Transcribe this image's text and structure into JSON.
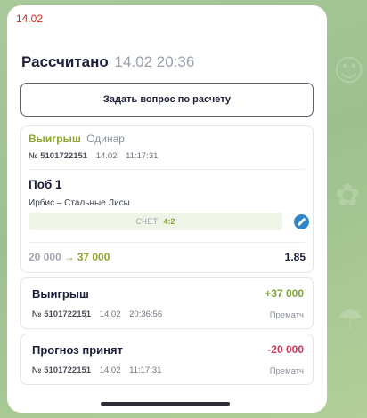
{
  "corner_date": "14.02",
  "header": {
    "title": "Рассчитано",
    "date": "14.02 20:36"
  },
  "ask_button": {
    "label": "Задать вопрос по расчету"
  },
  "bet": {
    "status": "Выигрыш",
    "type": "Одинар",
    "number": "№ 5101722151",
    "date": "14.02",
    "time": "11:17:31",
    "outcome": "Поб 1",
    "event": "Ирбис – Стальные Лисы",
    "score_label": "СЧЕТ",
    "score_value": "4:2",
    "sport_icon": "hockey-puck-icon",
    "stake": "20 000",
    "arrow": "→",
    "payout": "37 000",
    "odds": "1.85"
  },
  "transactions": [
    {
      "title": "Выигрыш",
      "amount": "+37 000",
      "number": "№ 5101722151",
      "date": "14.02",
      "time": "20:36:56",
      "kind": "Прематч"
    },
    {
      "title": "Прогноз принят",
      "amount": "-20 000",
      "number": "№ 5101722151",
      "date": "14.02",
      "time": "11:17:31",
      "kind": "Прематч"
    }
  ],
  "colors": {
    "win_green": "#8aa328",
    "positive": "#7fa23a",
    "negative": "#c4395a",
    "accent_blue": "#2f86c9",
    "background": "#a9c99a"
  }
}
